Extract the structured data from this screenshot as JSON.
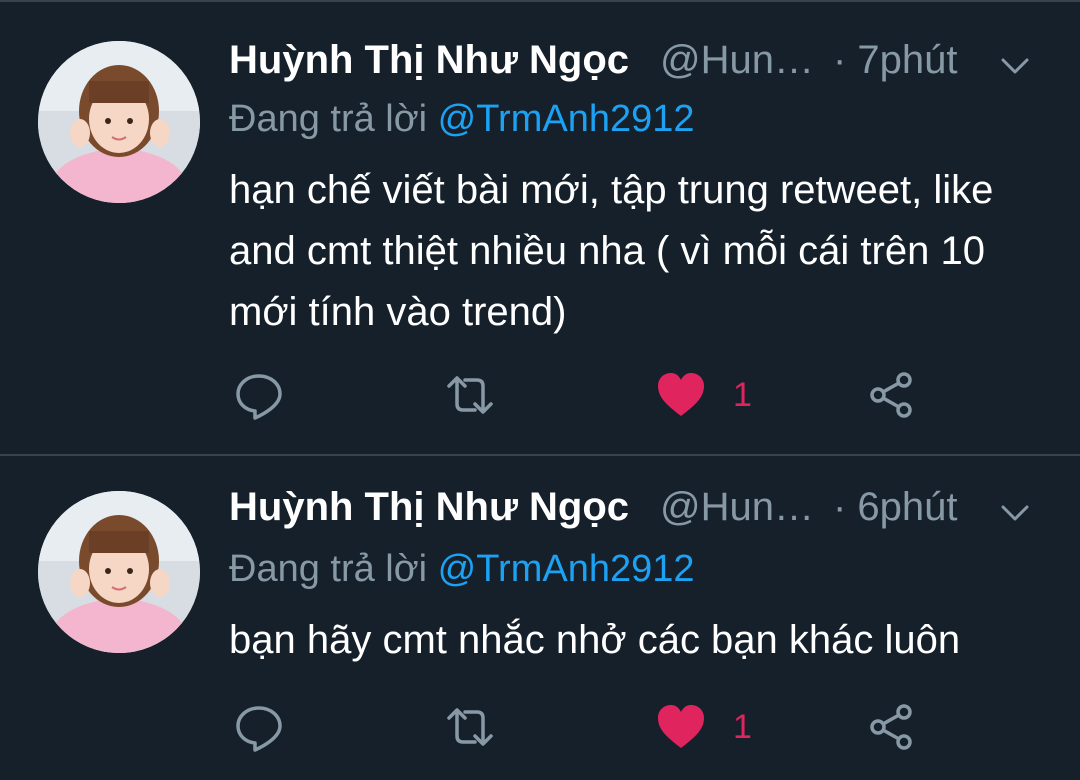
{
  "tweets": [
    {
      "author_name": "Huỳnh Thị Như Ngọc",
      "handle": "@Hun…",
      "time": "· 7phút",
      "reply_prefix": "Đang trả lời ",
      "reply_to": "@TrmAnh2912",
      "text": "hạn chế viết bài mới, tập trung retweet, like and cmt thiệt nhiều nha ( vì mỗi cái trên 10 mới tính vào trend)",
      "like_count": "1",
      "liked": true
    },
    {
      "author_name": "Huỳnh Thị Như Ngọc",
      "handle": "@Hun…",
      "time": "· 6phút",
      "reply_prefix": "Đang trả lời ",
      "reply_to": "@TrmAnh2912",
      "text": "bạn hãy cmt nhắc nhở các bạn khác luôn",
      "like_count": "1",
      "liked": true
    }
  ],
  "icons": {
    "reply": "reply-icon",
    "retweet": "retweet-icon",
    "like": "heart-icon",
    "share": "share-icon",
    "caret": "chevron-down-icon"
  },
  "colors": {
    "background": "#15202b",
    "divider": "#38444d",
    "secondary_text": "#8899a6",
    "mention": "#1da1f2",
    "like": "#e0245e"
  }
}
